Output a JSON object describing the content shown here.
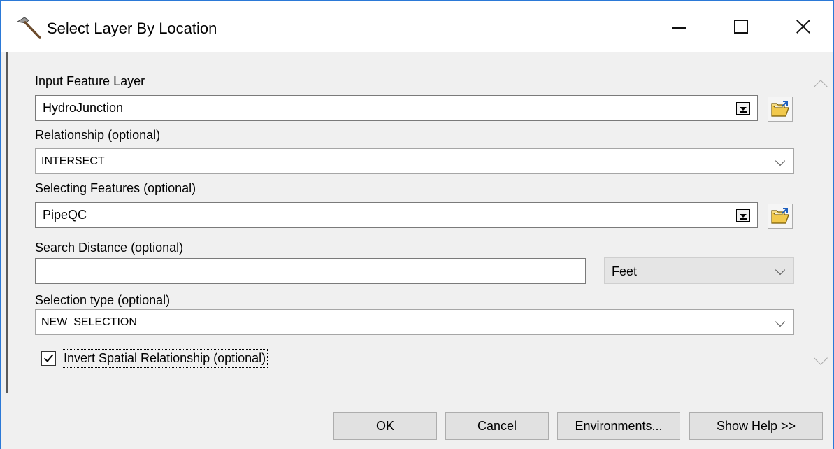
{
  "window": {
    "title": "Select Layer By Location"
  },
  "form": {
    "input_feature_layer": {
      "label": "Input Feature Layer",
      "value": "HydroJunction"
    },
    "relationship": {
      "label": "Relationship (optional)",
      "value": "INTERSECT"
    },
    "selecting_features": {
      "label": "Selecting Features (optional)",
      "value": "PipeQC"
    },
    "search_distance": {
      "label": "Search Distance (optional)",
      "value": "",
      "unit": "Feet"
    },
    "selection_type": {
      "label": "Selection type (optional)",
      "value": "NEW_SELECTION"
    },
    "invert": {
      "label": "Invert Spatial Relationship (optional)",
      "checked": true
    }
  },
  "buttons": {
    "ok": "OK",
    "cancel": "Cancel",
    "environments": "Environments...",
    "show_help": "Show Help >>"
  },
  "icons": {
    "app": "hammer-icon",
    "browse": "open-folder-icon"
  },
  "colors": {
    "window_border": "#2b79d7",
    "folder_yellow": "#f2c94c"
  }
}
